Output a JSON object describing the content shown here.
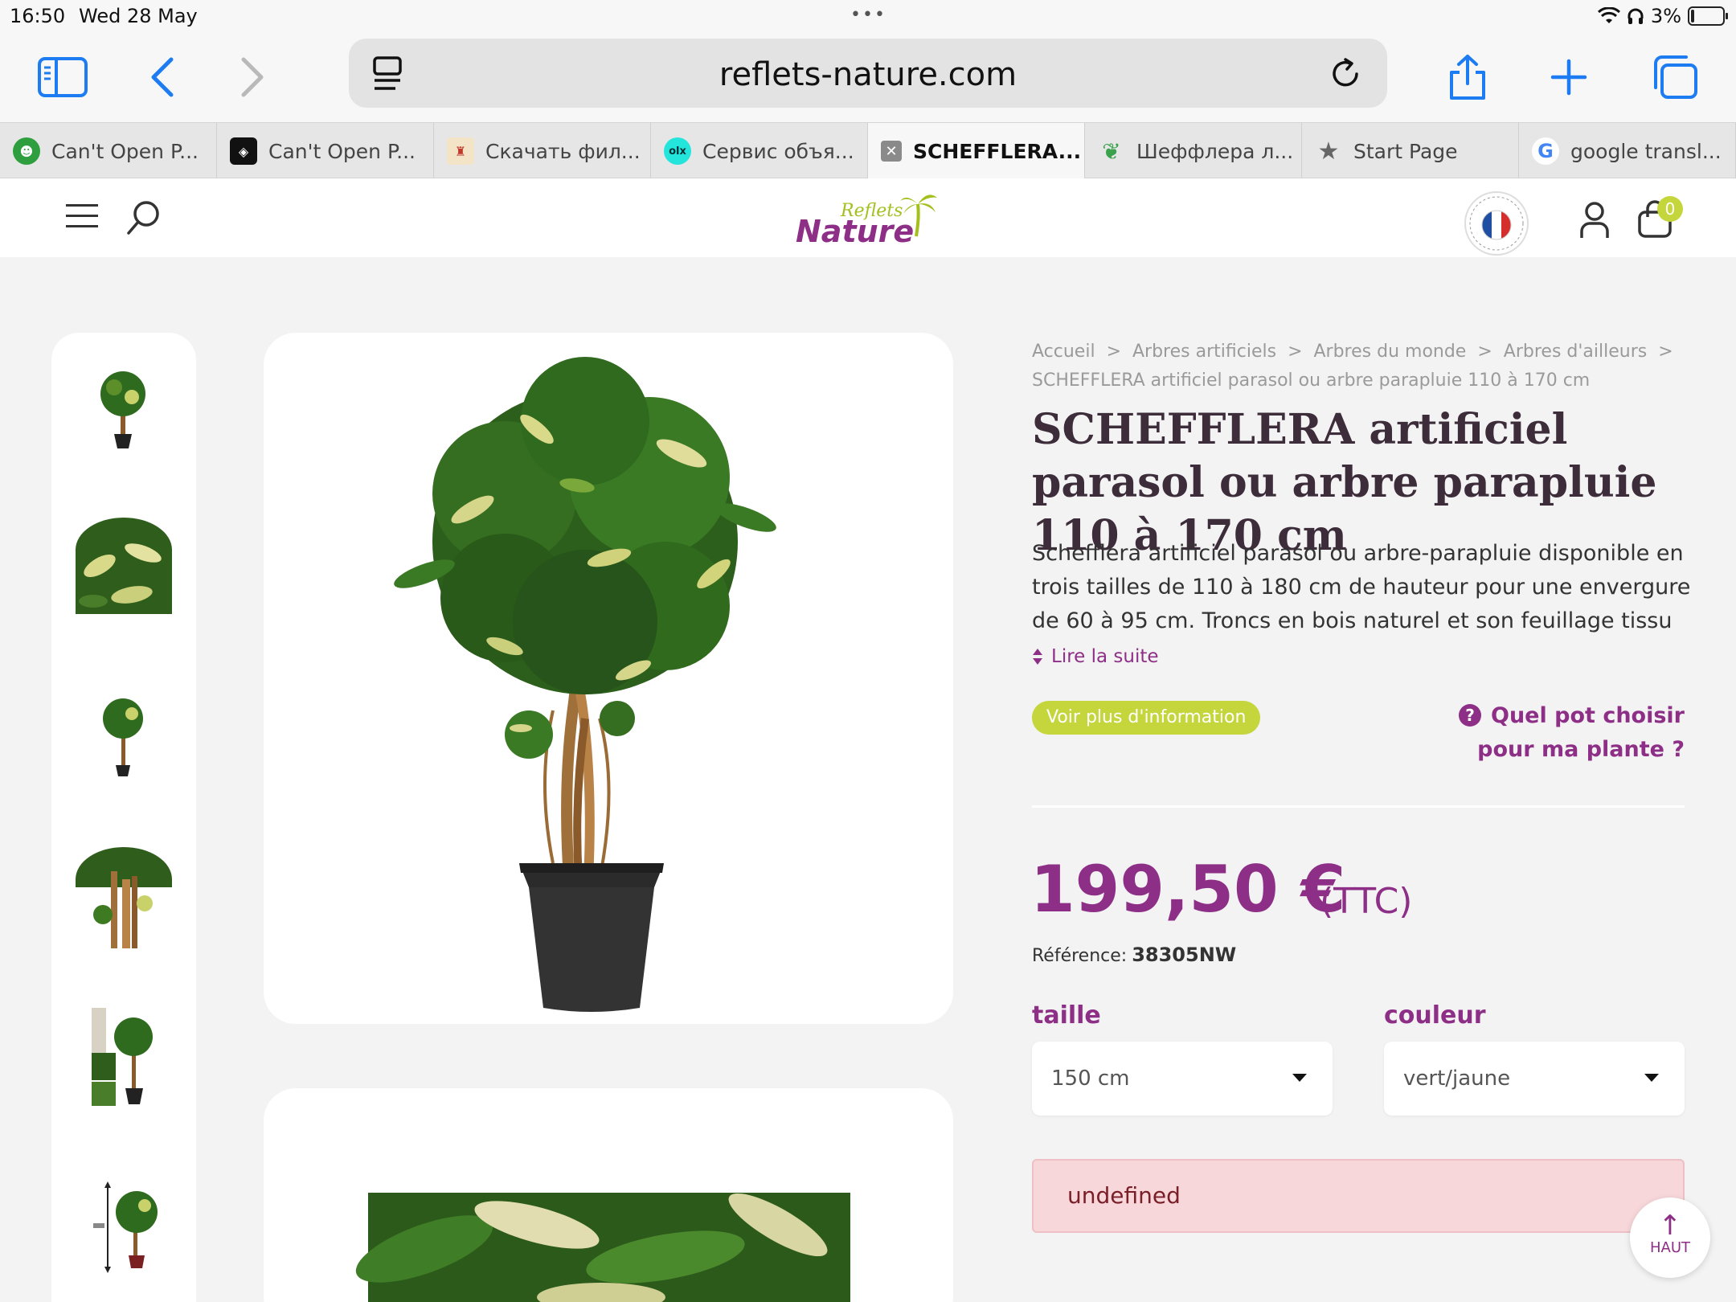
{
  "status_bar": {
    "time": "16:50",
    "date": "Wed 28 May",
    "battery": "3%"
  },
  "browser": {
    "url": "reflets-nature.com",
    "tabs": [
      {
        "label": "Can't Open P...",
        "icon": "frog-favicon",
        "color": "#2e9e3e"
      },
      {
        "label": "Can't Open P...",
        "icon": "diamond-favicon",
        "color": "#111111"
      },
      {
        "label": "Скачать фил...",
        "icon": "castle-favicon",
        "color": "#c0392b"
      },
      {
        "label": "Сервис объя...",
        "icon": "olx-favicon",
        "color": "#23e5db"
      },
      {
        "label": "SCHEFFLERA...",
        "icon": "close-icon",
        "color": "#777777",
        "active": true
      },
      {
        "label": "Шеффлера л...",
        "icon": "plant-favicon",
        "color": "#3aa24a"
      },
      {
        "label": "Start Page",
        "icon": "star-icon",
        "color": "#666666"
      },
      {
        "label": "google transl...",
        "icon": "google-favicon",
        "color": "#4285f4"
      }
    ]
  },
  "site": {
    "logo_top": "Reflets",
    "logo_main": "Nature",
    "cart_count": "0"
  },
  "breadcrumb": {
    "items": [
      "Accueil",
      "Arbres artificiels",
      "Arbres du monde",
      "Arbres d'ailleurs"
    ],
    "sep": ">",
    "current": "SCHEFFLERA artificiel parasol ou arbre parapluie 110 à 170 cm"
  },
  "product": {
    "title": "SCHEFFLERA artificiel parasol ou arbre parapluie 110 à 170 cm",
    "description": "Schefflera artificiel parasol ou arbre-parapluie disponible en trois tailles de 110 à 180 cm de hauteur pour une envergure de 60 à 95 cm. Troncs en bois naturel et son feuillage tissu",
    "read_more": "Lire la suite",
    "more_info_button": "Voir plus d'information",
    "help_link": "Quel pot choisir pour ma plante ?",
    "price": "199,50 €",
    "tax_label": "(TTC)",
    "reference_label": "Référence:",
    "reference": "38305NW",
    "size_label": "taille",
    "size_value": "150 cm",
    "color_label": "couleur",
    "color_value": "vert/jaune",
    "alert": "undefined",
    "back_to_top": "HAUT"
  },
  "colors": {
    "brand_purple": "#8e2f87",
    "brand_green": "#c4d63c",
    "ios_blue": "#1e7cf2"
  }
}
